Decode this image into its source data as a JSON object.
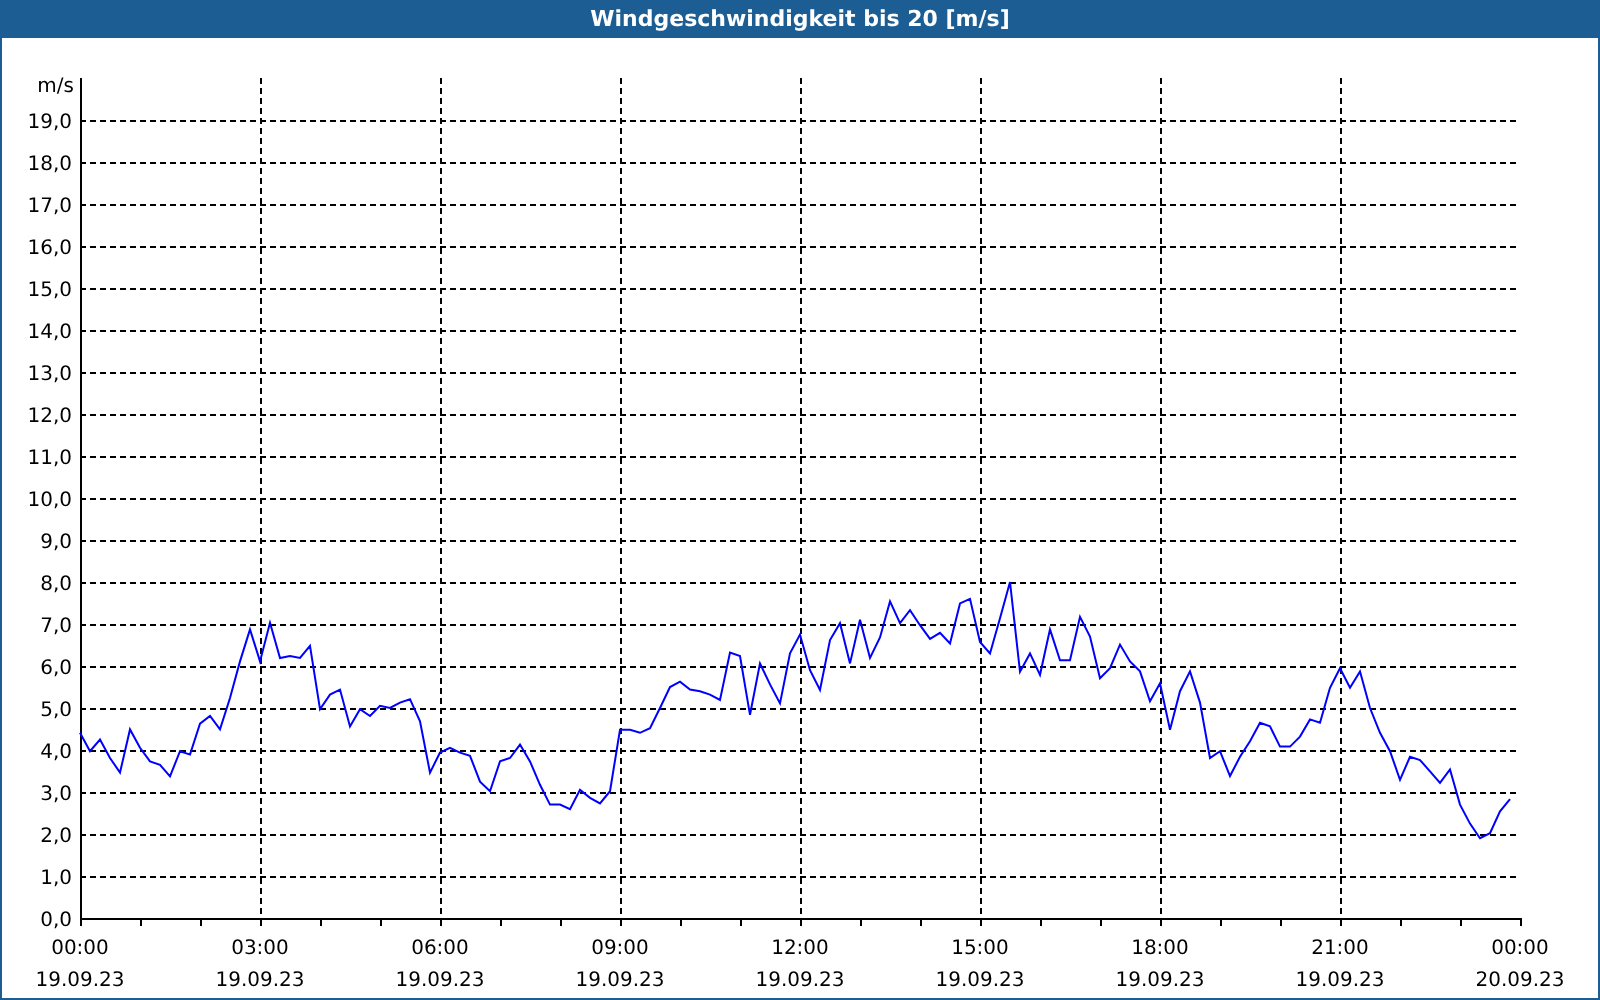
{
  "chart_data": {
    "type": "line",
    "title": "Windgeschwindigkeit bis 20 [m/s]",
    "ylabel": "m/s",
    "ylim": [
      0,
      20
    ],
    "grid": true,
    "yticks": [
      {
        "value": 0,
        "label": "0,0"
      },
      {
        "value": 1,
        "label": "1,0"
      },
      {
        "value": 2,
        "label": "2,0"
      },
      {
        "value": 3,
        "label": "3,0"
      },
      {
        "value": 4,
        "label": "4,0"
      },
      {
        "value": 5,
        "label": "5,0"
      },
      {
        "value": 6,
        "label": "6,0"
      },
      {
        "value": 7,
        "label": "7,0"
      },
      {
        "value": 8,
        "label": "8,0"
      },
      {
        "value": 9,
        "label": "9,0"
      },
      {
        "value": 10,
        "label": "10,0"
      },
      {
        "value": 11,
        "label": "11,0"
      },
      {
        "value": 12,
        "label": "12,0"
      },
      {
        "value": 13,
        "label": "13,0"
      },
      {
        "value": 14,
        "label": "14,0"
      },
      {
        "value": 15,
        "label": "15,0"
      },
      {
        "value": 16,
        "label": "16,0"
      },
      {
        "value": 17,
        "label": "17,0"
      },
      {
        "value": 18,
        "label": "18,0"
      },
      {
        "value": 19,
        "label": "19,0"
      }
    ],
    "categories": [
      "00:00\n19.09.23",
      null,
      null,
      null,
      null,
      null,
      null,
      null,
      null,
      null,
      null,
      null,
      null,
      null,
      null,
      null,
      null,
      null,
      "03:00\n19.09.23",
      null,
      null,
      null,
      null,
      null,
      null,
      null,
      null,
      null,
      null,
      null,
      null,
      null,
      null,
      null,
      null,
      null,
      "06:00\n19.09.23",
      null,
      null,
      null,
      null,
      null,
      null,
      null,
      null,
      null,
      null,
      null,
      null,
      null,
      null,
      null,
      null,
      null,
      "09:00\n19.09.23",
      null,
      null,
      null,
      null,
      null,
      null,
      null,
      null,
      null,
      null,
      null,
      null,
      null,
      null,
      null,
      null,
      null,
      "12:00\n19.09.23",
      null,
      null,
      null,
      null,
      null,
      null,
      null,
      null,
      null,
      null,
      null,
      null,
      null,
      null,
      null,
      null,
      null,
      "15:00\n19.09.23",
      null,
      null,
      null,
      null,
      null,
      null,
      null,
      null,
      null,
      null,
      null,
      null,
      null,
      null,
      null,
      null,
      null,
      "18:00\n19.09.23",
      null,
      null,
      null,
      null,
      null,
      null,
      null,
      null,
      null,
      null,
      null,
      null,
      null,
      null,
      null,
      null,
      null,
      "21:00\n19.09.23",
      null,
      null,
      null,
      null,
      null,
      null,
      null,
      null,
      null,
      null,
      null,
      null,
      null,
      null,
      null,
      null,
      null,
      "00:00\n20.09.23"
    ],
    "series": [
      {
        "color": "#0000ff",
        "values": [
          4.41,
          3.97,
          4.25,
          3.81,
          3.46,
          4.49,
          4.05,
          3.73,
          3.65,
          3.37,
          3.97,
          3.89,
          4.63,
          4.81,
          4.49,
          5.24,
          6.11,
          6.87,
          6.11,
          7.03,
          6.19,
          6.24,
          6.19,
          6.48,
          4.97,
          5.32,
          5.44,
          4.56,
          4.97,
          4.81,
          5.05,
          5.0,
          5.13,
          5.21,
          4.68,
          3.46,
          3.94,
          4.05,
          3.94,
          3.86,
          3.25,
          3.02,
          3.73,
          3.81,
          4.13,
          3.73,
          3.17,
          2.7,
          2.7,
          2.59,
          3.05,
          2.86,
          2.73,
          3.02,
          4.48,
          4.48,
          4.41,
          4.52,
          5.0,
          5.5,
          5.63,
          5.44,
          5.4,
          5.32,
          5.19,
          6.32,
          6.24,
          4.84,
          6.06,
          5.56,
          5.11,
          6.3,
          6.75,
          5.9,
          5.43,
          6.62,
          7.02,
          6.06,
          7.1,
          6.19,
          6.68,
          7.54,
          7.02,
          7.33,
          6.97,
          6.65,
          6.79,
          6.54,
          7.49,
          7.6,
          6.57,
          6.3,
          7.14,
          8.0,
          5.86,
          6.3,
          5.79,
          6.87,
          6.14,
          6.14,
          7.17,
          6.7,
          5.71,
          5.95,
          6.51,
          6.11,
          5.87,
          5.16,
          5.59,
          4.48,
          5.4,
          5.87,
          5.13,
          3.81,
          3.97,
          3.38,
          3.84,
          4.21,
          4.65,
          4.56,
          4.08,
          4.08,
          4.32,
          4.73,
          4.65,
          5.48,
          5.95,
          5.48,
          5.87,
          5.0,
          4.41,
          3.97,
          3.29,
          3.84,
          3.76,
          3.49,
          3.22,
          3.54,
          2.7,
          2.25,
          1.9,
          2.02,
          2.54,
          2.83,
          null
        ]
      }
    ]
  }
}
